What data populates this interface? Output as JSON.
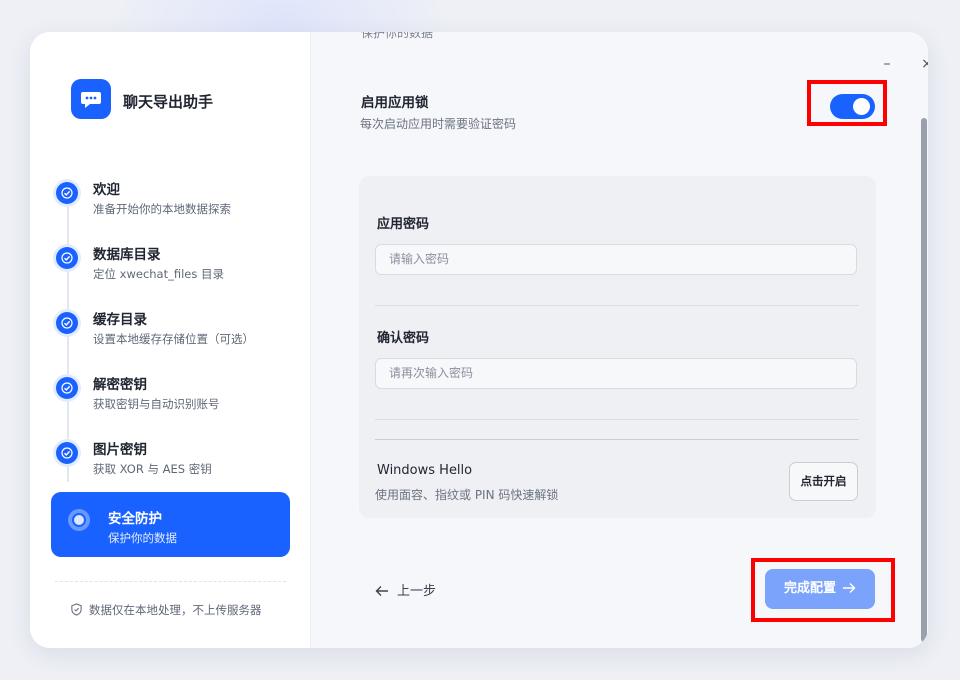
{
  "app": {
    "title": "聊天导出助手"
  },
  "steps": [
    {
      "title": "欢迎",
      "desc": "准备开始你的本地数据探索"
    },
    {
      "title": "数据库目录",
      "desc": "定位 xwechat_files 目录"
    },
    {
      "title": "缓存目录",
      "desc": "设置本地缓存存储位置（可选）"
    },
    {
      "title": "解密密钥",
      "desc": "获取密钥与自动识别账号"
    },
    {
      "title": "图片密钥",
      "desc": "获取 XOR 与 AES 密钥"
    }
  ],
  "active_step": {
    "title": "安全防护",
    "desc": "保护你的数据"
  },
  "sidebar_footer": {
    "privacy_text": "数据仅在本地处理，不上传服务器"
  },
  "window_controls": {
    "minimize": "–",
    "close": "×"
  },
  "main": {
    "cut_text": "保护你的数据",
    "app_lock": {
      "title": "启用应用锁",
      "desc": "每次启动应用时需要验证密码",
      "enabled": true
    },
    "password": {
      "label": "应用密码",
      "placeholder": "请输入密码"
    },
    "confirm": {
      "label": "确认密码",
      "placeholder": "请再次输入密码"
    },
    "windows_hello": {
      "title": "Windows Hello",
      "desc": "使用面容、指纹或 PIN 码快速解锁",
      "button": "点击开启"
    },
    "back_label": "上一步",
    "finish_label": "完成配置"
  },
  "colors": {
    "accent": "#1a62ff",
    "finish_disabled": "#7ba3fc",
    "highlight": "#ff0000"
  },
  "icons": {
    "logo": "chat-export-icon",
    "step_done": "check-icon",
    "privacy": "shield-icon",
    "back": "arrow-left-icon",
    "finish": "arrow-right-icon"
  }
}
